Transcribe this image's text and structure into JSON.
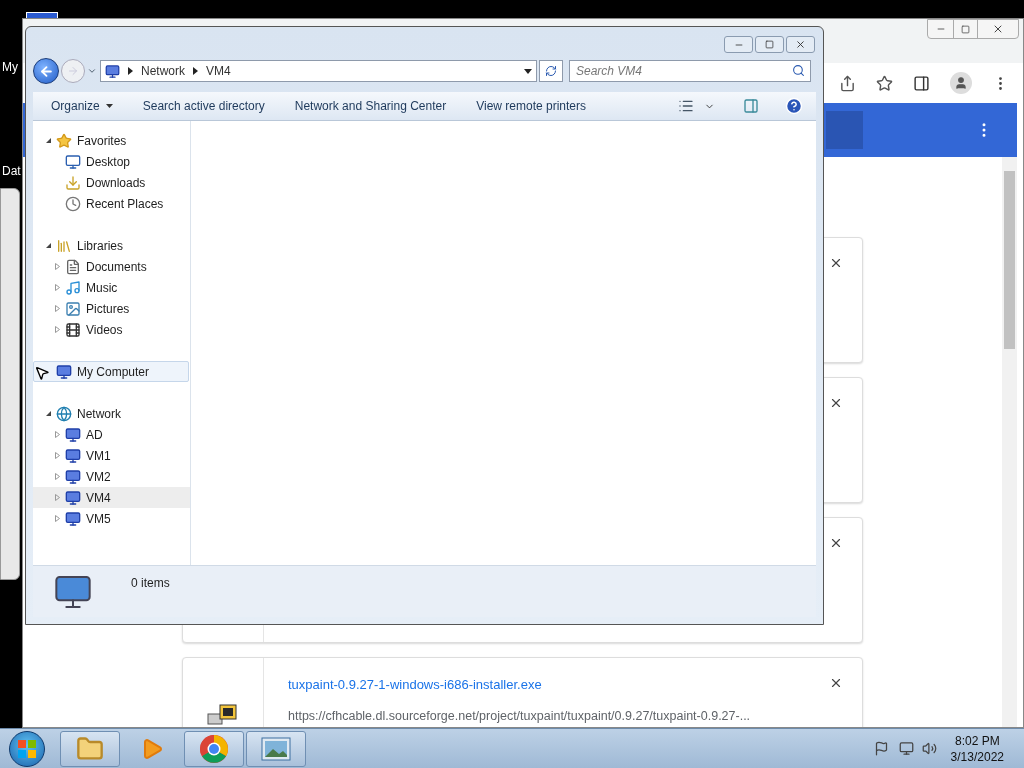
{
  "desktop": {
    "labels": [
      "My",
      "Dat"
    ]
  },
  "browser": {
    "downloads": [
      {
        "kind": "covered"
      },
      {
        "kind": "covered"
      },
      {
        "kind": "covered"
      },
      {
        "kind": "file",
        "name": "tuxpaint-0.9.27-1-windows-i686-installer.exe",
        "url": "https://cfhcable.dl.sourceforge.net/project/tuxpaint/tuxpaint/0.9.27/tuxpaint-0.9.27-..."
      }
    ]
  },
  "explorer": {
    "breadcrumb": [
      "Network",
      "VM4"
    ],
    "search": {
      "placeholder": "Search VM4"
    },
    "commands": [
      {
        "label": "Organize",
        "menu": true
      },
      {
        "label": "Search active directory",
        "menu": false
      },
      {
        "label": "Network and Sharing Center",
        "menu": false
      },
      {
        "label": "View remote printers",
        "menu": false
      }
    ],
    "nav": [
      {
        "label": "Favorites",
        "kind": "favorites",
        "expanded": true,
        "hovered": false,
        "children": [
          {
            "label": "Desktop",
            "kind": "desktop",
            "expandable": false,
            "selected": false
          },
          {
            "label": "Downloads",
            "kind": "downloads",
            "expandable": false,
            "selected": false
          },
          {
            "label": "Recent Places",
            "kind": "recent",
            "expandable": false,
            "selected": false
          }
        ]
      },
      {
        "label": "Libraries",
        "kind": "libraries",
        "expanded": true,
        "hovered": false,
        "children": [
          {
            "label": "Documents",
            "kind": "documents",
            "expandable": true,
            "selected": false
          },
          {
            "label": "Music",
            "kind": "music",
            "expandable": true,
            "selected": false
          },
          {
            "label": "Pictures",
            "kind": "pictures",
            "expandable": true,
            "selected": false
          },
          {
            "label": "Videos",
            "kind": "videos",
            "expandable": true,
            "selected": false
          }
        ]
      },
      {
        "label": "My Computer",
        "kind": "computer",
        "expanded": false,
        "hovered": true
      },
      {
        "label": "Network",
        "kind": "network",
        "expanded": true,
        "hovered": false,
        "children": [
          {
            "label": "AD",
            "kind": "computer",
            "expandable": true,
            "selected": false
          },
          {
            "label": "VM1",
            "kind": "computer",
            "expandable": true,
            "selected": false
          },
          {
            "label": "VM2",
            "kind": "computer",
            "expandable": true,
            "selected": false
          },
          {
            "label": "VM4",
            "kind": "computer",
            "expandable": true,
            "selected": true
          },
          {
            "label": "VM5",
            "kind": "computer",
            "expandable": true,
            "selected": false
          }
        ]
      }
    ],
    "status": "0 items"
  },
  "taskbar": {
    "apps": [
      {
        "kind": "folder",
        "running": true
      },
      {
        "kind": "media",
        "running": false
      },
      {
        "kind": "chrome",
        "running": true
      },
      {
        "kind": "photos",
        "running": true
      }
    ],
    "time": "8:02 PM",
    "date": "3/13/2022"
  }
}
